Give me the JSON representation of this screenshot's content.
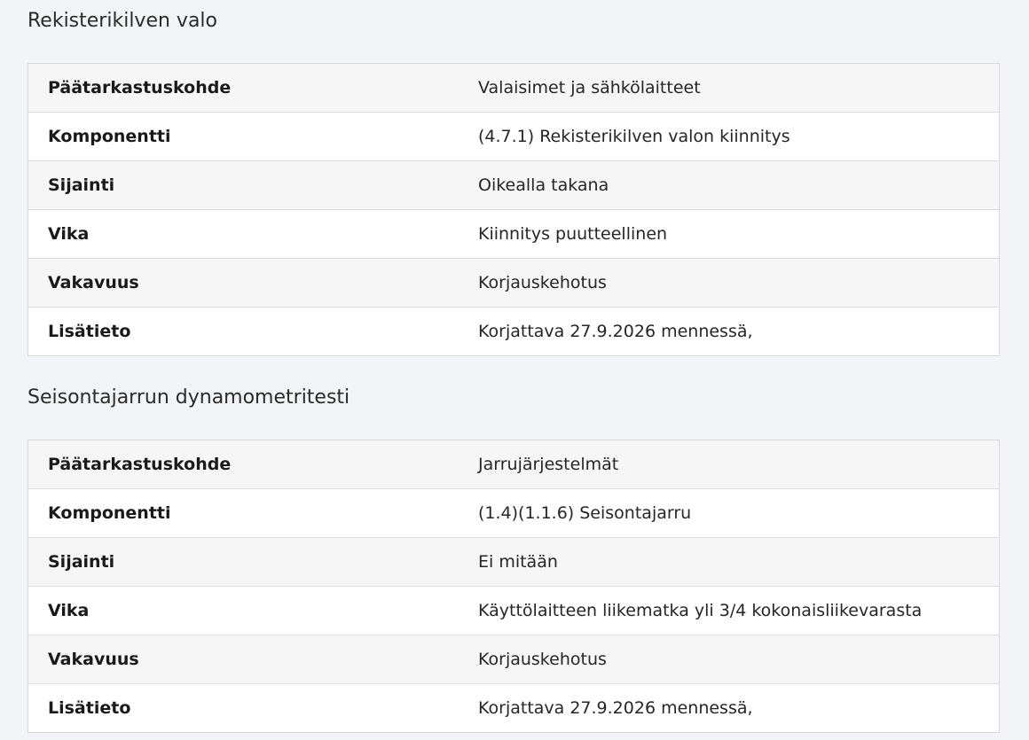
{
  "sections": [
    {
      "title": "Rekisterikilven valo",
      "rows": [
        {
          "label": "Päätarkastuskohde",
          "value": "Valaisimet ja sähkölaitteet"
        },
        {
          "label": "Komponentti",
          "value": "(4.7.1) Rekisterikilven valon kiinnitys"
        },
        {
          "label": "Sijainti",
          "value": "Oikealla takana"
        },
        {
          "label": "Vika",
          "value": "Kiinnitys puutteellinen"
        },
        {
          "label": "Vakavuus",
          "value": "Korjauskehotus"
        },
        {
          "label": "Lisätieto",
          "value": "Korjattava 27.9.2026 mennessä,"
        }
      ]
    },
    {
      "title": "Seisontajarrun dynamometritesti",
      "rows": [
        {
          "label": "Päätarkastuskohde",
          "value": "Jarrujärjestelmät"
        },
        {
          "label": "Komponentti",
          "value": "(1.4)(1.1.6) Seisontajarru"
        },
        {
          "label": "Sijainti",
          "value": "Ei mitään"
        },
        {
          "label": "Vika",
          "value": "Käyttölaitteen liikematka yli 3/4 kokonaisliikevarasta"
        },
        {
          "label": "Vakavuus",
          "value": "Korjauskehotus"
        },
        {
          "label": "Lisätieto",
          "value": "Korjattava 27.9.2026 mennessä,"
        }
      ]
    }
  ]
}
